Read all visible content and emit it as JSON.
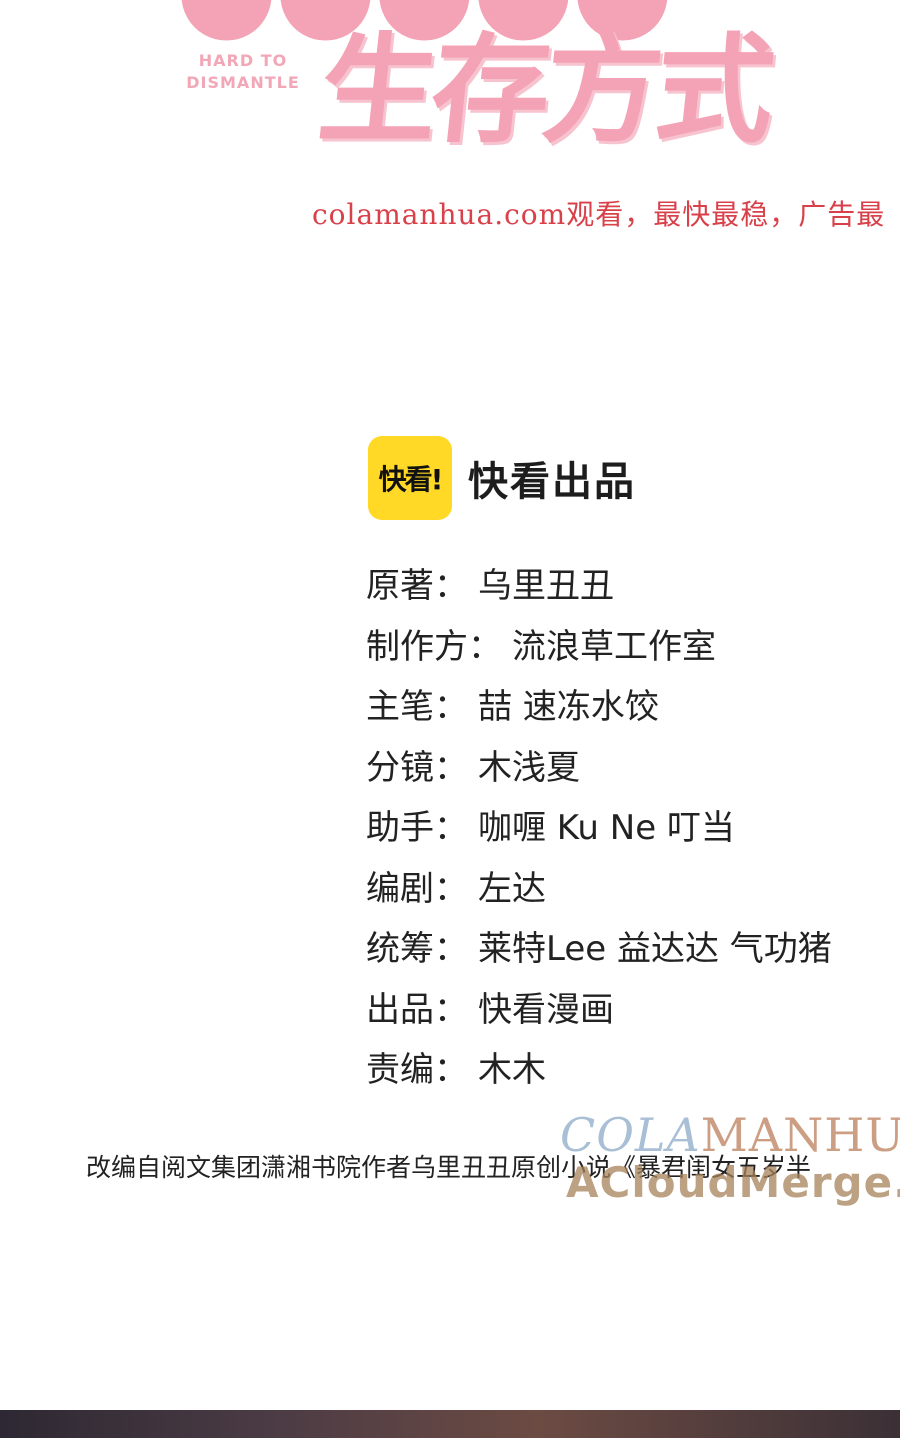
{
  "header": {
    "subtitle_en_line1": "HARD TO",
    "subtitle_en_line2": "DISMANTLE",
    "title_visible": "生存方式",
    "site_notice": "colamanhua.com观看，最快最稳，广告最"
  },
  "brand": {
    "logo_text": "快看!",
    "publisher_text": "快看出品"
  },
  "credits": [
    {
      "label": "原著",
      "value": "乌里丑丑"
    },
    {
      "label": "制作方",
      "value": "流浪草工作室"
    },
    {
      "label": "主笔",
      "value": "喆 速冻水饺"
    },
    {
      "label": "分镜",
      "value": "木浅夏"
    },
    {
      "label": "助手",
      "value": "咖喱 Ku Ne 叮当"
    },
    {
      "label": "编剧",
      "value": "左达"
    },
    {
      "label": "统筹",
      "value": "莱特Lee 益达达 气功猪"
    },
    {
      "label": "出品",
      "value": "快看漫画"
    },
    {
      "label": "责编",
      "value": "木木"
    }
  ],
  "colon": "：",
  "source_line": "改编自阅文集团潇湘书院作者乌里丑丑原创小说《暴君闺女五岁半",
  "watermarks": {
    "cola_part1": "COLA",
    "cola_part2": "MANHUA",
    "acloud": "ACloudMerge.c"
  },
  "colors": {
    "title_pink": "#f4a3b6",
    "site_red": "#d9414a",
    "logo_yellow": "#ffd926"
  }
}
